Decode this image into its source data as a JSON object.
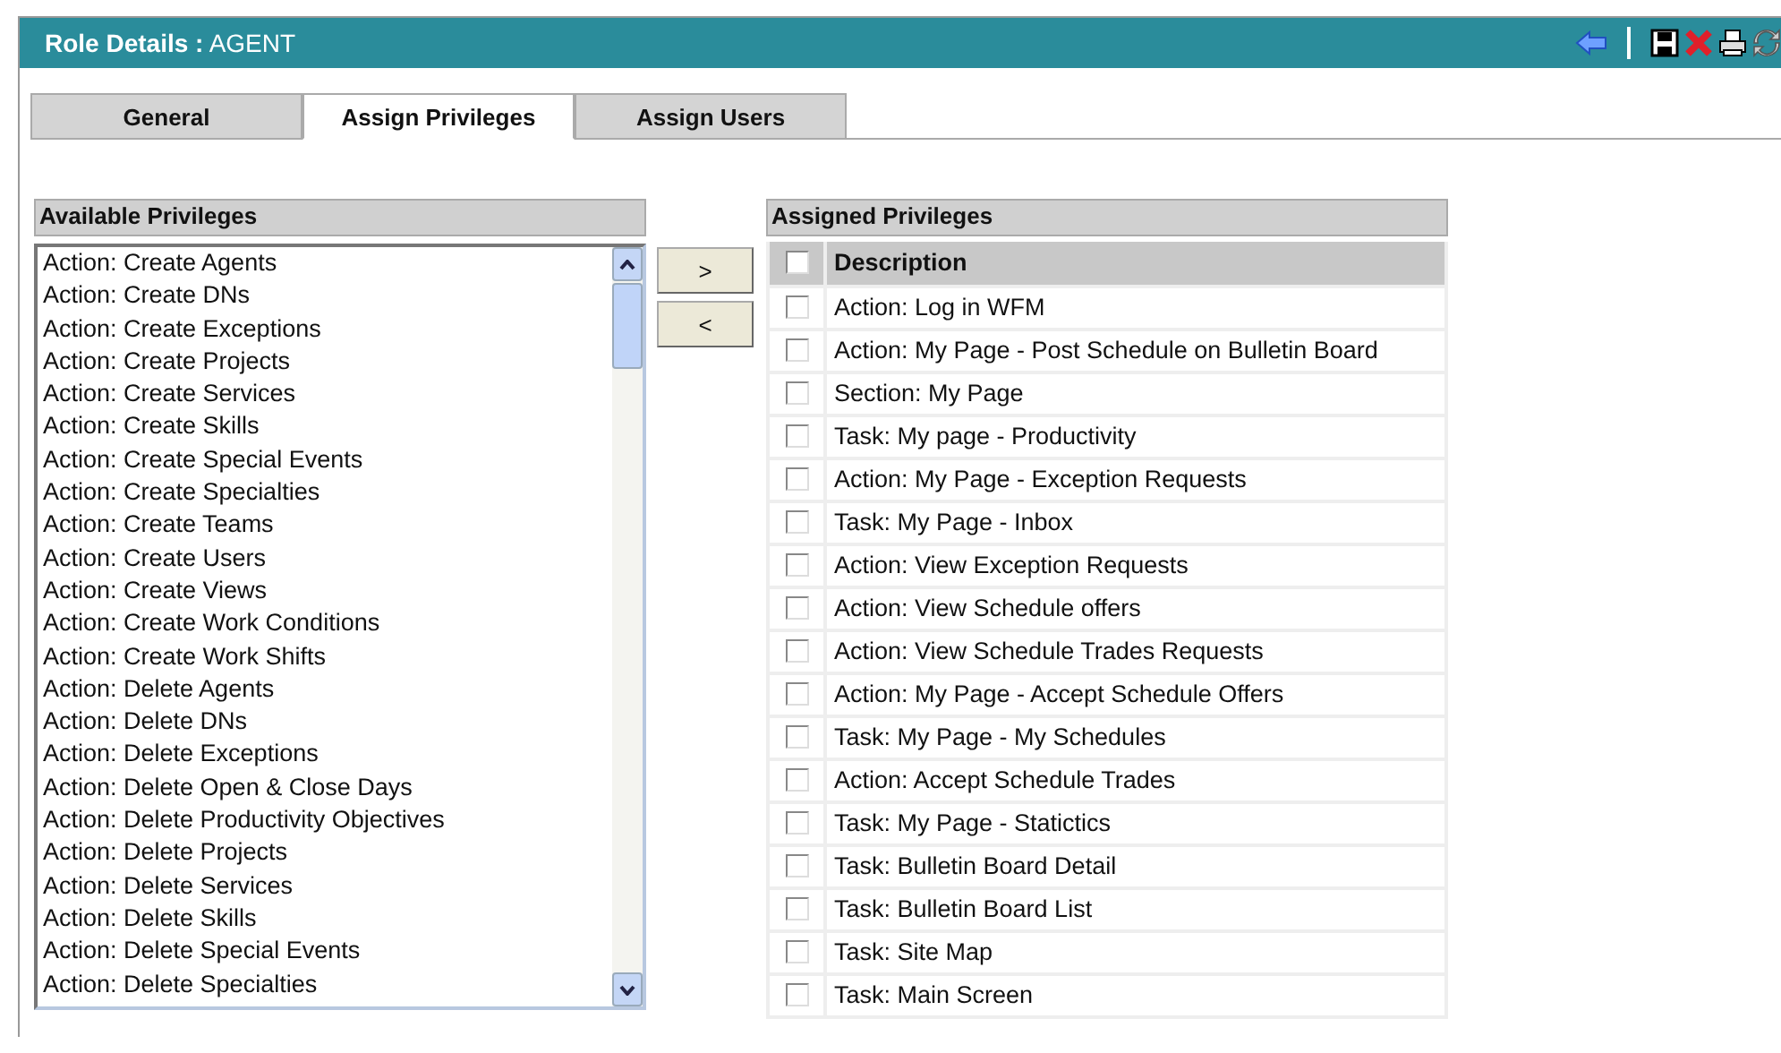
{
  "header": {
    "title": "**Role Details :** AGENT"
  },
  "tabs": [
    {
      "label": "General",
      "selected": false
    },
    {
      "label": "Assign Privileges",
      "selected": true
    },
    {
      "label": "Assign Users",
      "selected": false
    }
  ],
  "available": {
    "title": "Available Privileges",
    "items": [
      "Action: Create Agents",
      "Action: Create DNs",
      "Action: Create Exceptions",
      "Action: Create Projects",
      "Action: Create Services",
      "Action: Create Skills",
      "Action: Create Special Events",
      "Action: Create Specialties",
      "Action: Create Teams",
      "Action: Create Users",
      "Action: Create Views",
      "Action: Create Work Conditions",
      "Action: Create Work Shifts",
      "Action: Delete Agents",
      "Action: Delete DNs",
      "Action: Delete Exceptions",
      "Action: Delete Open & Close Days",
      "Action: Delete Productivity Objectives",
      "Action: Delete Projects",
      "Action: Delete Services",
      "Action: Delete Skills",
      "Action: Delete Special Events",
      "Action: Delete Specialties"
    ]
  },
  "move_buttons": [
    ">",
    "<"
  ],
  "assigned": {
    "title": "Assigned Privileges",
    "header": {
      "label": "Description",
      "checked": false
    },
    "rows": [
      {
        "description": "Action: Log in WFM",
        "checked": false
      },
      {
        "description": "Action: My Page - Post Schedule on Bulletin Board",
        "checked": false
      },
      {
        "description": "Section: My Page",
        "checked": false
      },
      {
        "description": "Task: My page - Productivity",
        "checked": false
      },
      {
        "description": "Action: My Page - Exception Requests",
        "checked": false
      },
      {
        "description": "Task: My Page - Inbox",
        "checked": false
      },
      {
        "description": "Action: View Exception Requests",
        "checked": false
      },
      {
        "description": "Action: View Schedule offers",
        "checked": false
      },
      {
        "description": "Action: View Schedule Trades Requests",
        "checked": false
      },
      {
        "description": "Action: My Page - Accept Schedule Offers",
        "checked": false
      },
      {
        "description": "Task: My Page - My Schedules",
        "checked": false
      },
      {
        "description": "Action: Accept Schedule Trades",
        "checked": false
      },
      {
        "description": "Task: My Page - Statictics",
        "checked": false
      },
      {
        "description": "Task: Bulletin Board Detail",
        "checked": false
      },
      {
        "description": "Task: Bulletin Board List",
        "checked": false
      },
      {
        "description": "Task: Site Map",
        "checked": false
      },
      {
        "description": "Task: Main Screen",
        "checked": false
      }
    ]
  }
}
